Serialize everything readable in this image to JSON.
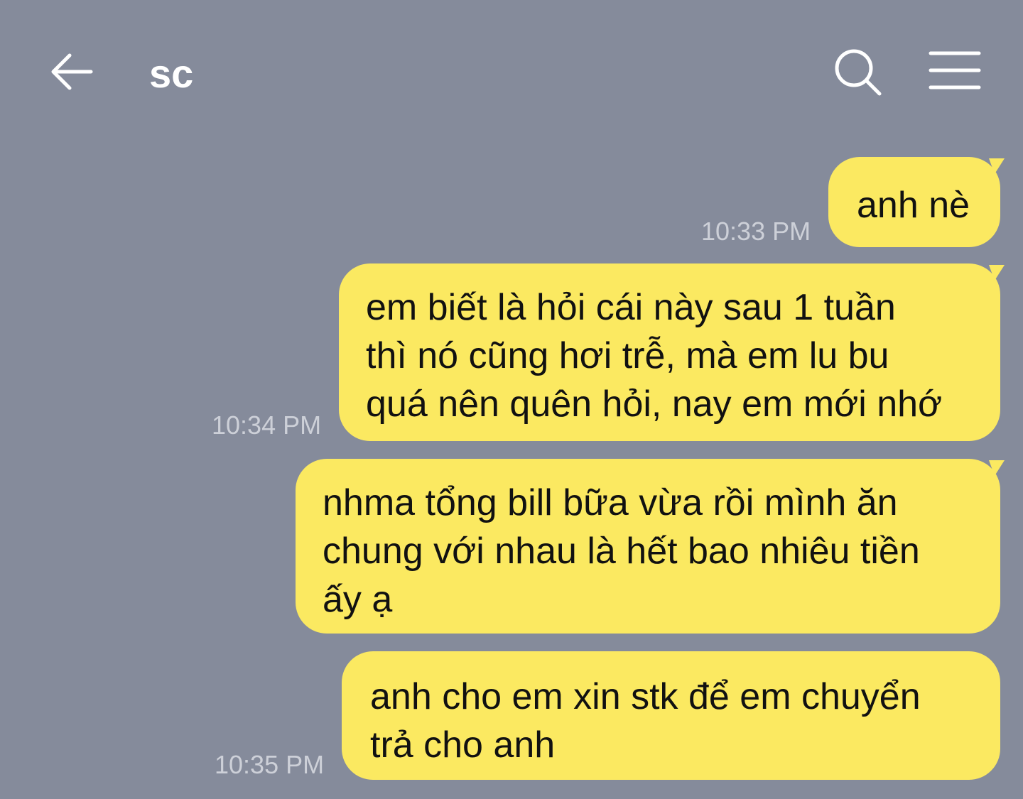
{
  "header": {
    "title": "sc",
    "back_icon": "arrow-left-icon",
    "search_icon": "search-icon",
    "menu_icon": "hamburger-menu-icon"
  },
  "colors": {
    "background": "#858b9b",
    "bubble": "#fbe961",
    "timestamp": "#cdd0d8"
  },
  "messages": [
    {
      "text": "anh nè",
      "time": "10:33 PM"
    },
    {
      "text": "em biết là hỏi cái này sau 1 tuần\nthì nó cũng hơi trễ, mà em lu bu\nquá nên quên hỏi, nay em mới nhớ",
      "time": "10:34 PM"
    },
    {
      "text": "nhma tổng bill bữa vừa rồi mình ăn\nchung với nhau là hết bao nhiêu tiền\nấy ạ",
      "time": ""
    },
    {
      "text": "anh cho em xin stk để em chuyển\ntrả cho anh",
      "time": "10:35 PM"
    }
  ]
}
